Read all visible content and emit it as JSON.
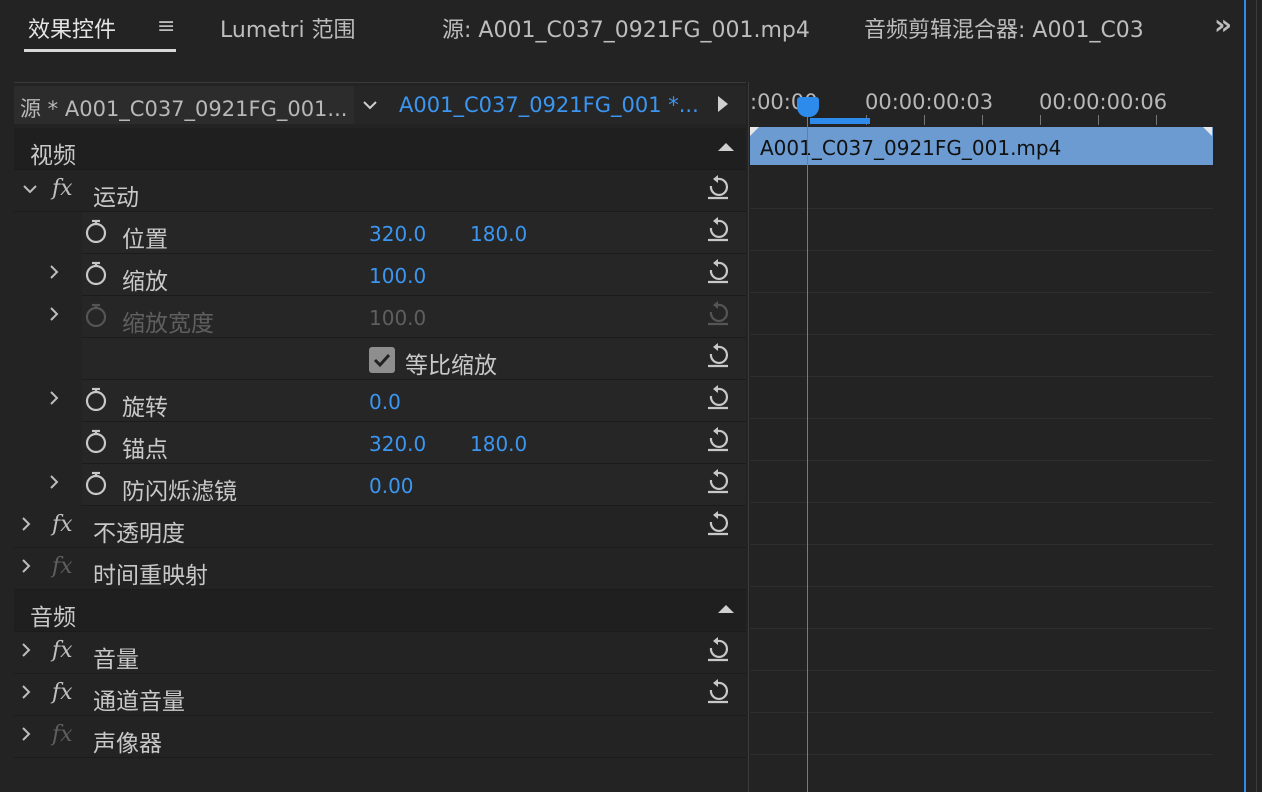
{
  "tabs": {
    "effect_controls": "效果控件",
    "menu_icon": "≡",
    "lumetri": "Lumetri 范围",
    "source": "源: A001_C037_0921FG_001.mp4",
    "audio_mixer": "音频剪辑混合器: A001_C03",
    "overflow": "»"
  },
  "clipbar": {
    "source_label": "源 * A001_C037_0921FG_001...",
    "sequence_label": "A001_C037_0921FG_001 *..."
  },
  "sections": {
    "video": "视频",
    "audio": "音频"
  },
  "effects": {
    "motion": "运动",
    "opacity": "不透明度",
    "time_remap": "时间重映射",
    "volume": "音量",
    "channel_volume": "通道音量",
    "panner": "声像器",
    "fx": "fx"
  },
  "params": {
    "position": {
      "label": "位置",
      "x": "320.0",
      "y": "180.0"
    },
    "scale": {
      "label": "缩放",
      "value": "100.0"
    },
    "scale_width": {
      "label": "缩放宽度",
      "value": "100.0"
    },
    "uniform_scale": {
      "label": "等比缩放",
      "checked": true
    },
    "rotation": {
      "label": "旋转",
      "value": "0.0"
    },
    "anchor": {
      "label": "锚点",
      "x": "320.0",
      "y": "180.0"
    },
    "anti_flicker": {
      "label": "防闪烁滤镜",
      "value": "0.00"
    }
  },
  "timeline": {
    "t0": ":00:00",
    "t1": "00:00:00:03",
    "t2": "00:00:00:06",
    "clip_name": "A001_C037_0921FG_001.mp4"
  },
  "colors": {
    "accent": "#2d8ceb",
    "value": "#3b96f2",
    "clip": "#6b9bd1"
  }
}
